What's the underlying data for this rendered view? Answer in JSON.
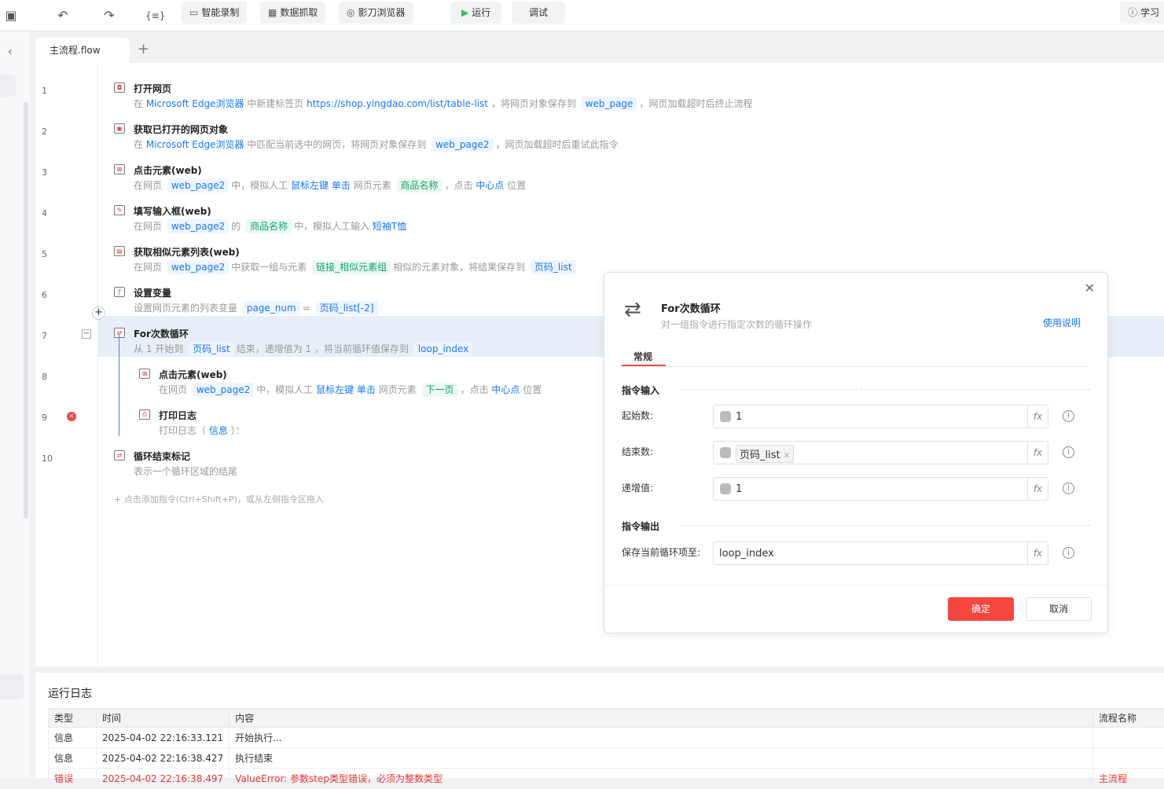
{
  "toolbar": {
    "record": "智能录制",
    "scrape": "数据抓取",
    "browser": "影刀浏览器",
    "run": "运行",
    "debug": "调试",
    "learn": "学习"
  },
  "tabs": {
    "main": "主流程.flow",
    "add": "+"
  },
  "flow": [
    {
      "num": "1",
      "title": "打开网页",
      "indent": 0,
      "desc": [
        {
          "t": "text",
          "v": "在 "
        },
        {
          "t": "link",
          "v": "Microsoft Edge浏览器"
        },
        {
          "t": "text",
          "v": " 中新建标签页 "
        },
        {
          "t": "link",
          "v": "https://shop.yingdao.com/list/table-list"
        },
        {
          "t": "text",
          "v": " ，将网页对象保存到 "
        },
        {
          "t": "var",
          "v": "web_page"
        },
        {
          "t": "text",
          "v": "，网页加载超时后终止流程"
        }
      ]
    },
    {
      "num": "2",
      "title": "获取已打开的网页对象",
      "indent": 0,
      "desc": [
        {
          "t": "text",
          "v": "在 "
        },
        {
          "t": "link",
          "v": "Microsoft Edge浏览器"
        },
        {
          "t": "text",
          "v": " 中匹配当前选中的网页，将网页对象保存到 "
        },
        {
          "t": "var",
          "v": "web_page2"
        },
        {
          "t": "text",
          "v": "，网页加载超时后重试此指令"
        }
      ]
    },
    {
      "num": "3",
      "title": "点击元素(web)",
      "indent": 0,
      "desc": [
        {
          "t": "text",
          "v": "在网页 "
        },
        {
          "t": "var",
          "v": "web_page2"
        },
        {
          "t": "text",
          "v": "中，模拟人工 "
        },
        {
          "t": "link",
          "v": "鼠标左键 单击"
        },
        {
          "t": "text",
          "v": " 网页元素 "
        },
        {
          "t": "el",
          "v": "商品名称"
        },
        {
          "t": "text",
          "v": "，点击 "
        },
        {
          "t": "link",
          "v": "中心点"
        },
        {
          "t": "text",
          "v": " 位置"
        }
      ]
    },
    {
      "num": "4",
      "title": "填写输入框(web)",
      "indent": 0,
      "desc": [
        {
          "t": "text",
          "v": "在网页 "
        },
        {
          "t": "var",
          "v": "web_page2"
        },
        {
          "t": "text",
          "v": "的 "
        },
        {
          "t": "el",
          "v": "商品名称"
        },
        {
          "t": "text",
          "v": "中，模拟人工输入 "
        },
        {
          "t": "link",
          "v": "短袖T恤"
        }
      ]
    },
    {
      "num": "5",
      "title": "获取相似元素列表(web)",
      "indent": 0,
      "desc": [
        {
          "t": "text",
          "v": "在网页 "
        },
        {
          "t": "var",
          "v": "web_page2"
        },
        {
          "t": "text",
          "v": "中获取一组与元素 "
        },
        {
          "t": "el",
          "v": "链接_相似元素组"
        },
        {
          "t": "text",
          "v": "相似的元素对象，将结果保存到 "
        },
        {
          "t": "var",
          "v": "页码_list"
        }
      ]
    },
    {
      "num": "6",
      "title": "设置变量",
      "indent": 0,
      "desc": [
        {
          "t": "text",
          "v": "设置网页元素的列表变量 "
        },
        {
          "t": "var",
          "v": "page_num"
        },
        {
          "t": "text",
          "v": "= "
        },
        {
          "t": "var",
          "v": "页码_list[-2]"
        }
      ]
    },
    {
      "num": "7",
      "title": "For次数循环",
      "indent": 0,
      "selected": true,
      "desc": [
        {
          "t": "text",
          "v": "从 1 开始到 "
        },
        {
          "t": "var",
          "v": "页码_list"
        },
        {
          "t": "text",
          "v": "结束，递增值为 1 ，将当前循环值保存到 "
        },
        {
          "t": "var",
          "v": "loop_index"
        }
      ]
    },
    {
      "num": "8",
      "title": "点击元素(web)",
      "indent": 1,
      "desc": [
        {
          "t": "text",
          "v": "在网页 "
        },
        {
          "t": "var",
          "v": "web_page2"
        },
        {
          "t": "text",
          "v": "中，模拟人工 "
        },
        {
          "t": "link",
          "v": "鼠标左键 单击"
        },
        {
          "t": "text",
          "v": " 网页元素 "
        },
        {
          "t": "el",
          "v": "下一页"
        },
        {
          "t": "text",
          "v": "，点击 "
        },
        {
          "t": "link",
          "v": "中心点"
        },
        {
          "t": "text",
          "v": " 位置"
        }
      ]
    },
    {
      "num": "9",
      "title": "打印日志",
      "indent": 1,
      "error": true,
      "desc": [
        {
          "t": "text",
          "v": "打印日志（ "
        },
        {
          "t": "link",
          "v": "信息"
        },
        {
          "t": "text",
          "v": " ）："
        }
      ]
    },
    {
      "num": "10",
      "title": "循环结束标记",
      "indent": 0,
      "desc": [
        {
          "t": "text",
          "v": "表示一个循环区域的结尾"
        }
      ]
    }
  ],
  "add_hint": "+  点击添加指令(Ctrl+Shift+P)，或从左侧指令区拖入",
  "dialog": {
    "title": "For次数循环",
    "subtitle": "对一组指令进行指定次数的循环操作",
    "help": "使用说明",
    "tab": "常规",
    "input_section": "指令输入",
    "output_section": "指令输出",
    "start_label": "起始数:",
    "start_value": "1",
    "end_label": "结束数:",
    "end_value": "页码_list",
    "step_label": "递增值:",
    "step_value": "1",
    "save_label": "保存当前循环项至:",
    "save_value": "loop_index",
    "fx": "fx",
    "confirm": "确定",
    "cancel": "取消"
  },
  "log": {
    "title": "运行日志",
    "columns": [
      "类型",
      "时间",
      "内容",
      "流程名称"
    ],
    "rows": [
      [
        "信息",
        "2025-04-02 22:16:33.121",
        "开始执行...",
        ""
      ],
      [
        "信息",
        "2025-04-02 22:16:38.427",
        "执行结束",
        ""
      ],
      [
        "错误",
        "2025-04-02 22:16:38.497",
        "ValueError: 参数step类型错误，必须为整数类型",
        "主流程"
      ]
    ]
  },
  "colors": {
    "accent": "#1677ff",
    "danger": "#f5473f",
    "success": "#14a36a"
  }
}
